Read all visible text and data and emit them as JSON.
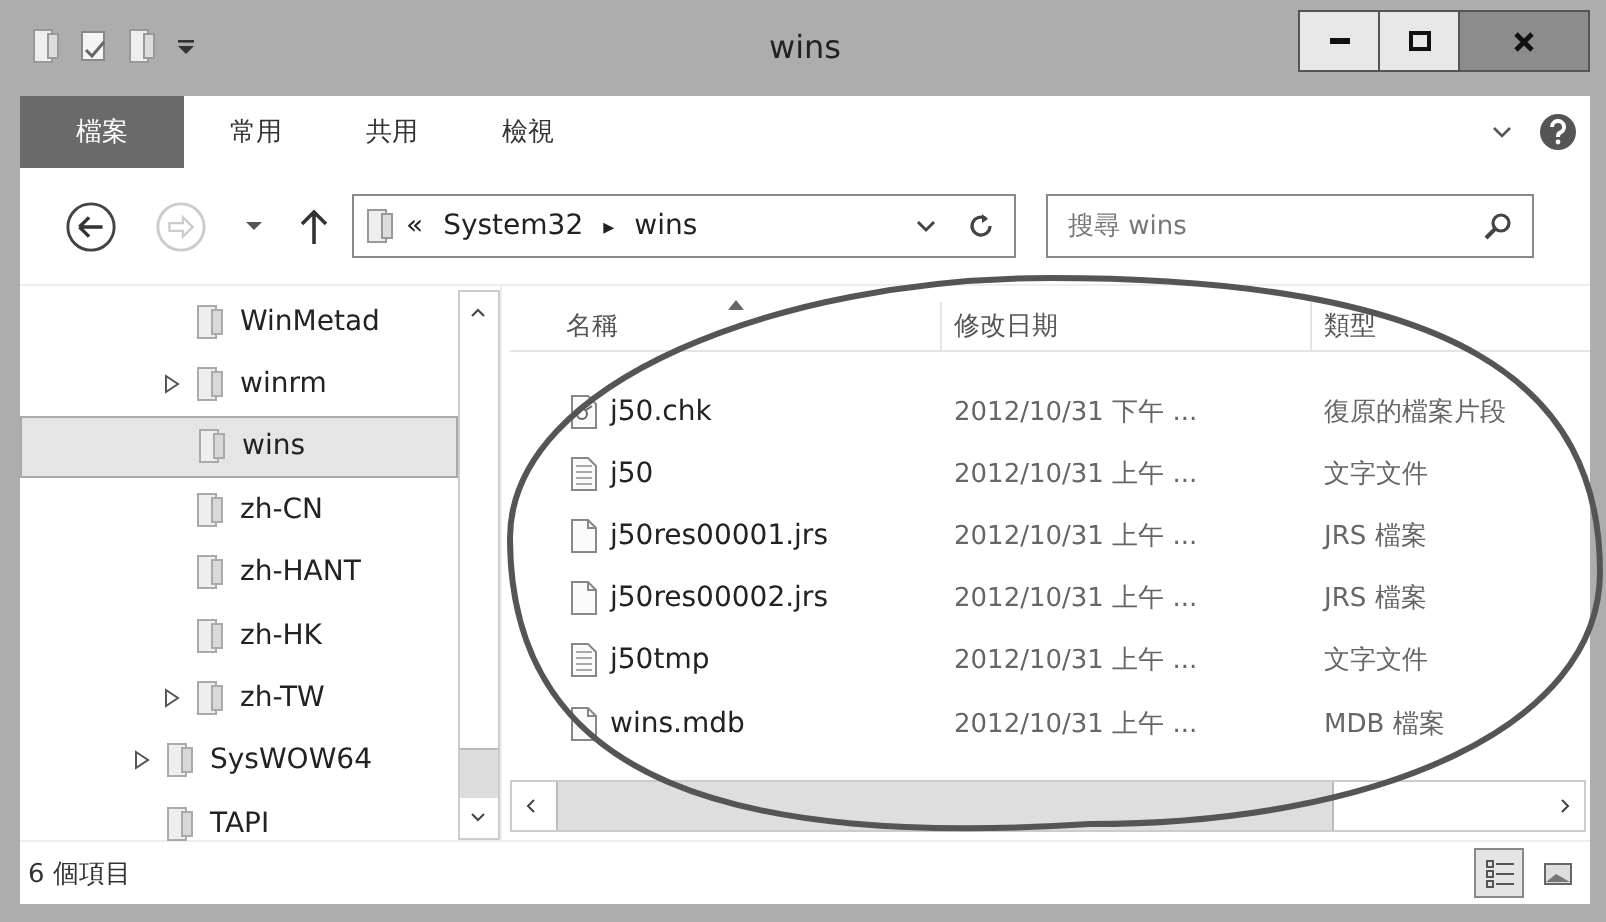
{
  "window": {
    "title": "wins"
  },
  "ribbon_tabs": [
    {
      "label": "檔案",
      "selected": true
    },
    {
      "label": "常用",
      "selected": false
    },
    {
      "label": "共用",
      "selected": false
    },
    {
      "label": "檢視",
      "selected": false
    }
  ],
  "address": {
    "prefix": "«",
    "segments": [
      "System32",
      "wins"
    ],
    "separator": "▸"
  },
  "search": {
    "placeholder": "搜尋 wins"
  },
  "tree": [
    {
      "children": [
        {
          "label": "WinMetad",
          "expandable": false,
          "selected": false
        },
        {
          "label": "winrm",
          "expandable": true,
          "selected": false
        },
        {
          "label": "wins",
          "expandable": false,
          "selected": true
        },
        {
          "label": "zh-CN",
          "expandable": false,
          "selected": false
        },
        {
          "label": "zh-HANT",
          "expandable": false,
          "selected": false
        },
        {
          "label": "zh-HK",
          "expandable": false,
          "selected": false
        },
        {
          "label": "zh-TW",
          "expandable": true,
          "selected": false
        }
      ]
    },
    {
      "label": "SysWOW64",
      "expandable": true,
      "selected": false
    },
    {
      "label": "TAPI",
      "expandable": false,
      "selected": false
    }
  ],
  "table": {
    "columns": [
      "名稱",
      "修改日期",
      "類型"
    ],
    "rows": [
      {
        "kind": "chk",
        "cells": [
          "j50.chk",
          "2012/10/31 下午 ...",
          "復原的檔案片段"
        ]
      },
      {
        "kind": "text",
        "cells": [
          "j50",
          "2012/10/31 上午 ...",
          "文字文件"
        ]
      },
      {
        "kind": "blank",
        "cells": [
          "j50res00001.jrs",
          "2012/10/31 上午 ...",
          "JRS 檔案"
        ]
      },
      {
        "kind": "blank",
        "cells": [
          "j50res00002.jrs",
          "2012/10/31 上午 ...",
          "JRS 檔案"
        ]
      },
      {
        "kind": "text",
        "cells": [
          "j50tmp",
          "2012/10/31 上午 ...",
          "文字文件"
        ]
      },
      {
        "kind": "blank",
        "cells": [
          "wins.mdb",
          "2012/10/31 上午 ...",
          "MDB 檔案"
        ]
      }
    ]
  },
  "status_bar": {
    "item_count": "6 個項目"
  }
}
